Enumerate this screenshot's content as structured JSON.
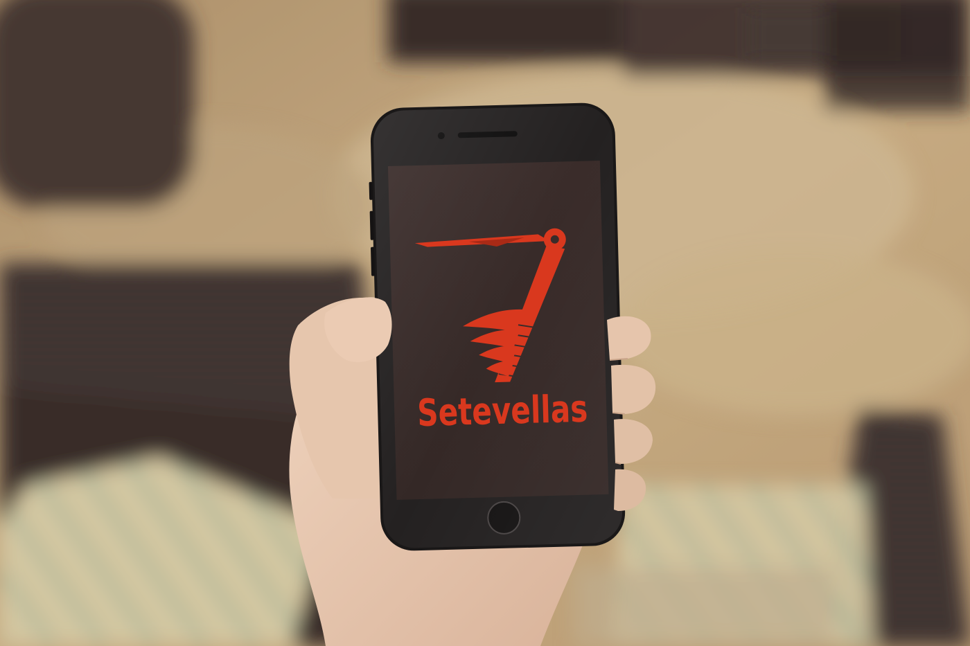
{
  "brand": {
    "name": "Setevellas",
    "color": "#d9381e"
  },
  "palette": {
    "floor_warm": "#c9a878",
    "floor_light": "#dcc39a",
    "wicker_dark": "#3a2e2b",
    "screen_bg": "#3b2d2b",
    "phone_body": "#1c1a1a",
    "skin": "#e8c8b0",
    "cushion_stripe_a": "#e9dcb3",
    "cushion_stripe_b": "#b9c3a3"
  }
}
